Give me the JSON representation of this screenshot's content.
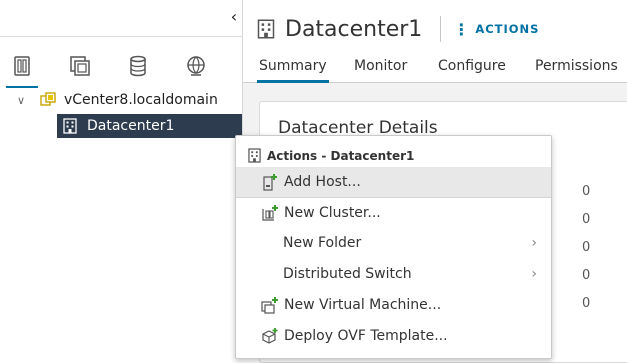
{
  "navigator": {
    "collapse_icon": "chevron-left-icon",
    "inventory_tabs": [
      {
        "name": "hosts-and-clusters",
        "icon": "hosts-clusters-icon",
        "active": true
      },
      {
        "name": "vms-and-templates",
        "icon": "vms-templates-icon",
        "active": false
      },
      {
        "name": "storage",
        "icon": "storage-icon",
        "active": false
      },
      {
        "name": "networking",
        "icon": "network-icon",
        "active": false
      }
    ],
    "tree": [
      {
        "label": "vCenter8.localdomain",
        "icon": "vcenter-icon",
        "expanded": true,
        "selected": false
      },
      {
        "label": "Datacenter1",
        "icon": "datacenter-icon",
        "selected": true
      }
    ]
  },
  "header": {
    "title": "Datacenter1",
    "title_icon": "datacenter-icon",
    "actions_label": "ACTIONS"
  },
  "tabs": [
    {
      "label": "Summary",
      "active": true
    },
    {
      "label": "Monitor",
      "active": false
    },
    {
      "label": "Configure",
      "active": false
    },
    {
      "label": "Permissions",
      "active": false
    }
  ],
  "summary": {
    "card_title": "Datacenter Details",
    "counts": [
      "0",
      "0",
      "0",
      "0",
      "0"
    ]
  },
  "context_menu": {
    "header": "Actions - Datacenter1",
    "items": [
      {
        "label": "Add Host...",
        "icon": "add-host-icon",
        "hovered": true
      },
      {
        "label": "New Cluster...",
        "icon": "new-cluster-icon"
      },
      {
        "label": "New Folder",
        "submenu": true
      },
      {
        "label": "Distributed Switch",
        "submenu": true
      },
      {
        "label": "New Virtual Machine...",
        "icon": "new-vm-icon"
      },
      {
        "label": "Deploy OVF Template...",
        "icon": "deploy-ovf-icon"
      }
    ]
  },
  "colors": {
    "accent": "#0072a3",
    "selected_bg": "#2d3d4f",
    "add_green": "#3c9a2e"
  }
}
